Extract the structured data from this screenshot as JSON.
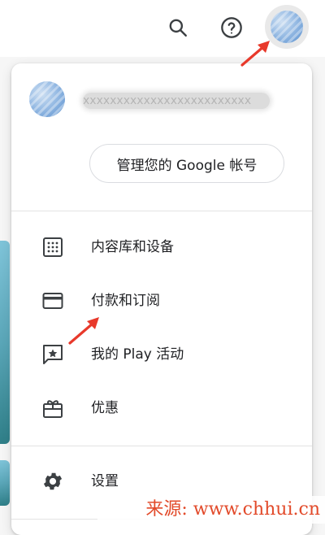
{
  "header": {
    "search_icon": "search-icon",
    "help_icon": "help-icon",
    "avatar": "account-avatar"
  },
  "account": {
    "email_obscured": "xxxxxxxxxxxxxxxxxxxxxxxxx",
    "manage_label": "管理您的 Google 帐号"
  },
  "menu": {
    "items": [
      {
        "label": "内容库和设备",
        "icon": "grid-icon"
      },
      {
        "label": "付款和订阅",
        "icon": "credit-card-icon"
      },
      {
        "label": "我的 Play 活动",
        "icon": "star-comment-icon"
      },
      {
        "label": "优惠",
        "icon": "gift-icon"
      },
      {
        "label": "设置",
        "icon": "gear-icon"
      }
    ]
  },
  "watermark": {
    "text": "来源: www.chhui.cn"
  },
  "colors": {
    "arrow": "#e8392b",
    "text": "#202124",
    "divider": "#e3e3e3"
  }
}
